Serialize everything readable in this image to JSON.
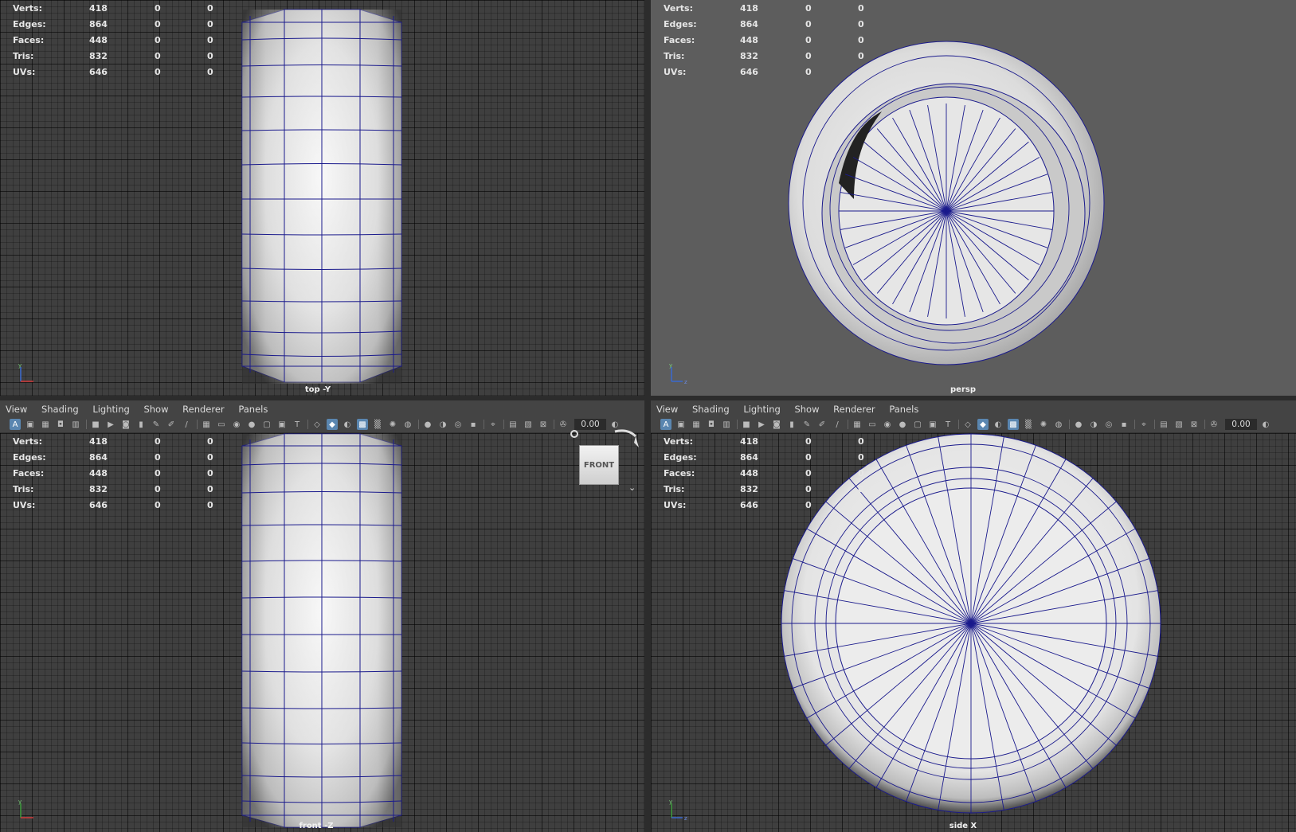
{
  "stats": {
    "rows": [
      {
        "label": "Verts:",
        "v1": "418",
        "v2": "0",
        "v3": "0"
      },
      {
        "label": "Edges:",
        "v1": "864",
        "v2": "0",
        "v3": "0"
      },
      {
        "label": "Faces:",
        "v1": "448",
        "v2": "0",
        "v3": "0"
      },
      {
        "label": "Tris:",
        "v1": "832",
        "v2": "0",
        "v3": "0"
      },
      {
        "label": "UVs:",
        "v1": "646",
        "v2": "0",
        "v3": "0"
      }
    ]
  },
  "menu": [
    "View",
    "Shading",
    "Lighting",
    "Show",
    "Renderer",
    "Panels"
  ],
  "toolbar": {
    "value": "0.00"
  },
  "viewports": {
    "top": "top -Y",
    "persp": "persp",
    "front": "front -Z",
    "side": "side X"
  },
  "viewcube": {
    "label": "FRONT"
  },
  "axis_labels": {
    "x": "x",
    "y": "y",
    "z": "z"
  },
  "colors": {
    "grid_bg": "#3f3f3f",
    "persp_bg": "#5d5d5d",
    "wire": "#1a1a8c",
    "menu_bg": "#444444",
    "active_icon": "#5a86b0"
  }
}
